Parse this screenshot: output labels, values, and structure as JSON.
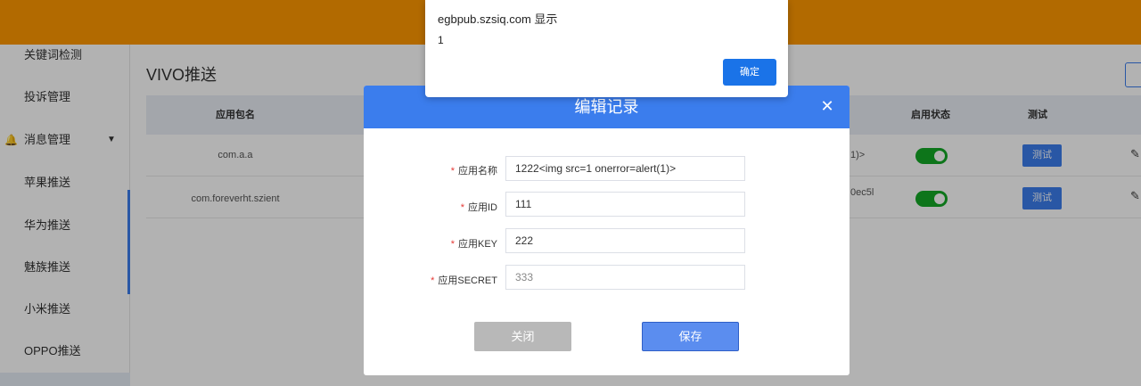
{
  "colors": {
    "header": "#ff9900",
    "accent": "#3b7ded",
    "toggle_on": "#13a826",
    "required": "#e53935"
  },
  "sidebar": {
    "items": [
      {
        "label": "关键词检测"
      },
      {
        "label": "投诉管理"
      },
      {
        "label": "消息管理",
        "icon": "bell-icon",
        "expanded": true
      },
      {
        "label": "苹果推送"
      },
      {
        "label": "华为推送"
      },
      {
        "label": "魅族推送"
      },
      {
        "label": "小米推送"
      },
      {
        "label": "OPPO推送"
      }
    ]
  },
  "page": {
    "title": "VIVO推送",
    "table": {
      "headers": {
        "package": "应用包名",
        "status": "启用状态",
        "test": "测试"
      },
      "rows": [
        {
          "package": "com.a.a",
          "partial": "1)>",
          "enabled": true,
          "test": "测试"
        },
        {
          "package": "com.foreverht.szient",
          "partial": "0ec5l",
          "enabled": true,
          "test": "测试"
        }
      ]
    }
  },
  "modal": {
    "title": "编辑记录",
    "fields": [
      {
        "label": "应用名称",
        "value": "1222<img src=1 onerror=alert(1)>"
      },
      {
        "label": "应用ID",
        "value": "111"
      },
      {
        "label": "应用KEY",
        "value": "222"
      },
      {
        "label": "应用SECRET",
        "value": "333"
      }
    ],
    "close_label": "关闭",
    "save_label": "保存"
  },
  "alert": {
    "origin": "egbpub.szsiq.com 显示",
    "message": "1",
    "ok_label": "确定"
  }
}
